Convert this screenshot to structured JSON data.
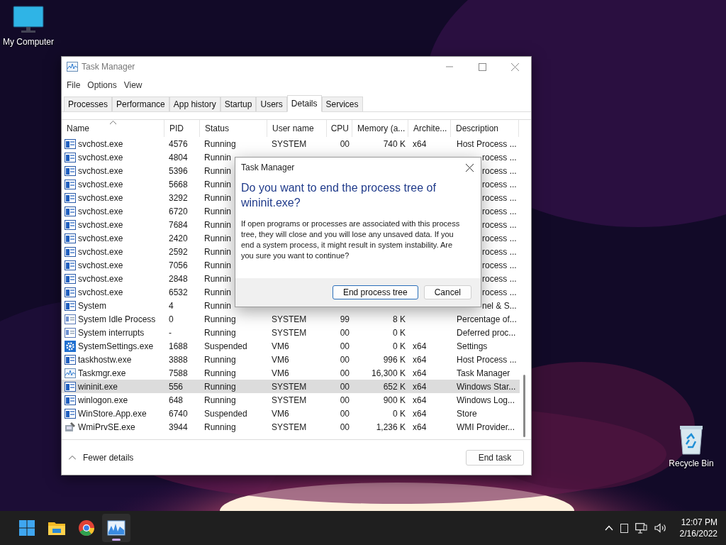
{
  "desktop_icons": [
    {
      "label": "My Computer",
      "kind": "computer"
    },
    {
      "label": "Recycle Bin",
      "kind": "recycle"
    }
  ],
  "window": {
    "title": "Task Manager",
    "menu": [
      "File",
      "Options",
      "View"
    ],
    "tabs": [
      {
        "label": "Processes",
        "selected": false
      },
      {
        "label": "Performance",
        "selected": false
      },
      {
        "label": "App history",
        "selected": false
      },
      {
        "label": "Startup",
        "selected": false
      },
      {
        "label": "Users",
        "selected": false
      },
      {
        "label": "Details",
        "selected": true
      },
      {
        "label": "Services",
        "selected": false
      }
    ],
    "columns": [
      {
        "label": "Name",
        "sorted": true
      },
      {
        "label": "PID",
        "sorted": false
      },
      {
        "label": "Status",
        "sorted": false
      },
      {
        "label": "User name",
        "sorted": false
      },
      {
        "label": "CPU",
        "sorted": false
      },
      {
        "label": "Memory (a...",
        "sorted": false
      },
      {
        "label": "Archite...",
        "sorted": false
      },
      {
        "label": "Description",
        "sorted": false
      }
    ],
    "rows": [
      {
        "kind": "app",
        "name": "svchost.exe",
        "pid": "4576",
        "status": "Running",
        "user": "SYSTEM",
        "cpu": "00",
        "memory": "740 K",
        "arch": "x64",
        "description": "Host Process ...",
        "selected": false
      },
      {
        "kind": "app",
        "name": "svchost.exe",
        "pid": "4804",
        "status": "Runnin",
        "description": "rocess ...",
        "selected": false
      },
      {
        "kind": "app",
        "name": "svchost.exe",
        "pid": "5396",
        "status": "Runnin",
        "description": "rocess ...",
        "selected": false
      },
      {
        "kind": "app",
        "name": "svchost.exe",
        "pid": "5668",
        "status": "Runnin",
        "description": "rocess ...",
        "selected": false
      },
      {
        "kind": "app",
        "name": "svchost.exe",
        "pid": "3292",
        "status": "Runnin",
        "description": "rocess ...",
        "selected": false
      },
      {
        "kind": "app",
        "name": "svchost.exe",
        "pid": "6720",
        "status": "Runnin",
        "description": "rocess ...",
        "selected": false
      },
      {
        "kind": "app",
        "name": "svchost.exe",
        "pid": "7684",
        "status": "Runnin",
        "description": "rocess ...",
        "selected": false
      },
      {
        "kind": "app",
        "name": "svchost.exe",
        "pid": "2420",
        "status": "Runnin",
        "description": "rocess ...",
        "selected": false
      },
      {
        "kind": "app",
        "name": "svchost.exe",
        "pid": "2592",
        "status": "Runnin",
        "description": "rocess ...",
        "selected": false
      },
      {
        "kind": "app",
        "name": "svchost.exe",
        "pid": "7056",
        "status": "Runnin",
        "description": "rocess ...",
        "selected": false
      },
      {
        "kind": "app",
        "name": "svchost.exe",
        "pid": "2848",
        "status": "Runnin",
        "description": "rocess ...",
        "selected": false
      },
      {
        "kind": "app",
        "name": "svchost.exe",
        "pid": "6532",
        "status": "Runnin",
        "description": "rocess ...",
        "selected": false
      },
      {
        "kind": "app",
        "name": "System",
        "pid": "4",
        "status": "Runnin",
        "description": "nel & S...",
        "selected": false
      },
      {
        "kind": "service",
        "name": "System Idle Process",
        "pid": "0",
        "status": "Running",
        "user": "SYSTEM",
        "cpu": "99",
        "memory": "8 K",
        "description": "Percentage of...",
        "selected": false
      },
      {
        "kind": "service",
        "name": "System interrupts",
        "pid": "-",
        "status": "Running",
        "user": "SYSTEM",
        "cpu": "00",
        "memory": "0 K",
        "description": "Deferred proc...",
        "selected": false
      },
      {
        "kind": "gear",
        "name": "SystemSettings.exe",
        "pid": "1688",
        "status": "Suspended",
        "user": "VM6",
        "cpu": "00",
        "memory": "0 K",
        "arch": "x64",
        "description": "Settings",
        "selected": false
      },
      {
        "kind": "app",
        "name": "taskhostw.exe",
        "pid": "3888",
        "status": "Running",
        "user": "VM6",
        "cpu": "00",
        "memory": "996 K",
        "arch": "x64",
        "description": "Host Process ...",
        "selected": false
      },
      {
        "kind": "chart",
        "name": "Taskmgr.exe",
        "pid": "7588",
        "status": "Running",
        "user": "VM6",
        "cpu": "00",
        "memory": "16,300 K",
        "arch": "x64",
        "description": "Task Manager",
        "selected": false
      },
      {
        "kind": "app",
        "name": "wininit.exe",
        "pid": "556",
        "status": "Running",
        "user": "SYSTEM",
        "cpu": "00",
        "memory": "652 K",
        "arch": "x64",
        "description": "Windows Star...",
        "selected": true
      },
      {
        "kind": "app",
        "name": "winlogon.exe",
        "pid": "648",
        "status": "Running",
        "user": "SYSTEM",
        "cpu": "00",
        "memory": "900 K",
        "arch": "x64",
        "description": "Windows Log...",
        "selected": false
      },
      {
        "kind": "app",
        "name": "WinStore.App.exe",
        "pid": "6740",
        "status": "Suspended",
        "user": "VM6",
        "cpu": "00",
        "memory": "0 K",
        "arch": "x64",
        "description": "Store",
        "selected": false
      },
      {
        "kind": "tool",
        "name": "WmiPrvSE.exe",
        "pid": "3944",
        "status": "Running",
        "user": "SYSTEM",
        "cpu": "00",
        "memory": "1,236 K",
        "arch": "x64",
        "description": "WMI Provider...",
        "selected": false
      }
    ],
    "footer": {
      "toggle": "Fewer details",
      "button": "End task"
    }
  },
  "dialog": {
    "title": "Task Manager",
    "heading": "Do you want to end the process tree of wininit.exe?",
    "message": "If open programs or processes are associated with this process tree, they will close and you will lose any unsaved data. If you end a system process, it might result in system instability. Are you sure you want to continue?",
    "buttons": [
      {
        "label": "End process tree",
        "selected": true
      },
      {
        "label": "Cancel",
        "selected": false
      }
    ]
  },
  "taskbar": {
    "apps": [
      {
        "kind": "start",
        "active": false
      },
      {
        "kind": "folder",
        "active": false
      },
      {
        "kind": "browser",
        "active": false
      },
      {
        "kind": "chart",
        "active": true
      }
    ],
    "time": "12:07 PM",
    "date": "2/16/2022"
  }
}
